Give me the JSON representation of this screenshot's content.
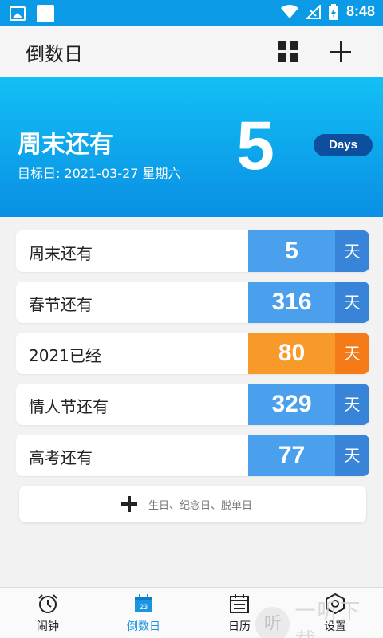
{
  "status_bar": {
    "time": "8:48"
  },
  "app_bar": {
    "title": "倒数日"
  },
  "hero": {
    "title": "周末还有",
    "date": "目标日: 2021-03-27 星期六",
    "count": "5",
    "unit_pill": "Days"
  },
  "events": [
    {
      "label": "周末还有",
      "count": "5",
      "unit": "天",
      "color": "blue"
    },
    {
      "label": "春节还有",
      "count": "316",
      "unit": "天",
      "color": "blue"
    },
    {
      "label": "2021已经",
      "count": "80",
      "unit": "天",
      "color": "orange"
    },
    {
      "label": "情人节还有",
      "count": "329",
      "unit": "天",
      "color": "blue"
    },
    {
      "label": "高考还有",
      "count": "77",
      "unit": "天",
      "color": "blue"
    }
  ],
  "add_event": {
    "hint": "生日、纪念日、脱单日"
  },
  "bottom_nav": [
    {
      "label": "闹钟",
      "icon": "alarm-clock-icon"
    },
    {
      "label": "倒数日",
      "icon": "calendar-23-icon",
      "badge": "23",
      "active": true
    },
    {
      "label": "日历",
      "icon": "calendar-list-icon"
    },
    {
      "label": "设置",
      "icon": "gear-icon"
    }
  ],
  "watermark": {
    "text": "一听下载",
    "glyph": "听"
  },
  "colors": {
    "primary": "#0b9ae6",
    "blue_num": "#4ba0ee",
    "blue_unit": "#3884d8",
    "orange_num": "#f89a2a",
    "orange_unit": "#f47b17",
    "pill": "#0d4f9e"
  }
}
